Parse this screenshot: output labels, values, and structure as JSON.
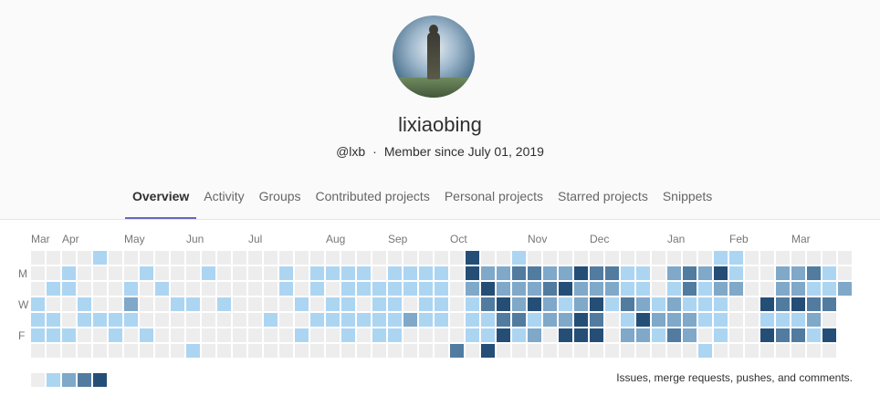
{
  "profile": {
    "name": "lixiaobing",
    "username": "@lxb",
    "separator": "·",
    "member_since": "Member since July 01, 2019"
  },
  "tabs": [
    {
      "label": "Overview",
      "active": true
    },
    {
      "label": "Activity"
    },
    {
      "label": "Groups"
    },
    {
      "label": "Contributed projects"
    },
    {
      "label": "Personal projects"
    },
    {
      "label": "Starred projects"
    },
    {
      "label": "Snippets"
    }
  ],
  "calendar": {
    "months": [
      {
        "label": "Mar",
        "week": 0
      },
      {
        "label": "Apr",
        "week": 2
      },
      {
        "label": "May",
        "week": 6
      },
      {
        "label": "Jun",
        "week": 10
      },
      {
        "label": "Jul",
        "week": 14
      },
      {
        "label": "Aug",
        "week": 19
      },
      {
        "label": "Sep",
        "week": 23
      },
      {
        "label": "Oct",
        "week": 27
      },
      {
        "label": "Nov",
        "week": 32
      },
      {
        "label": "Dec",
        "week": 36
      },
      {
        "label": "Jan",
        "week": 41
      },
      {
        "label": "Feb",
        "week": 45
      },
      {
        "label": "Mar",
        "week": 49
      }
    ],
    "day_labels": [
      {
        "label": "M",
        "row": 1
      },
      {
        "label": "W",
        "row": 3
      },
      {
        "label": "F",
        "row": 5
      }
    ],
    "level_colors": [
      "#ededed",
      "#acd5f2",
      "#7fa8c9",
      "#527ba0",
      "#254e77"
    ],
    "levels_by_weekday": [
      "00001000000000000000000000004001000000000000110000000",
      "00100001000100001011110111104223322433110232410022310",
      "01100010100000001010111111102422234222110131220022112",
      "1001002001101000010110110110134242124132121110043433-",
      "1101111000000001001111112110113312243014222110011120-",
      "1110010100000000010010110000114120444022132010043314-",
      "0000000000100000000000000003040000000000000100000000-"
    ],
    "note": "Issues, merge requests, pushes, and comments."
  }
}
